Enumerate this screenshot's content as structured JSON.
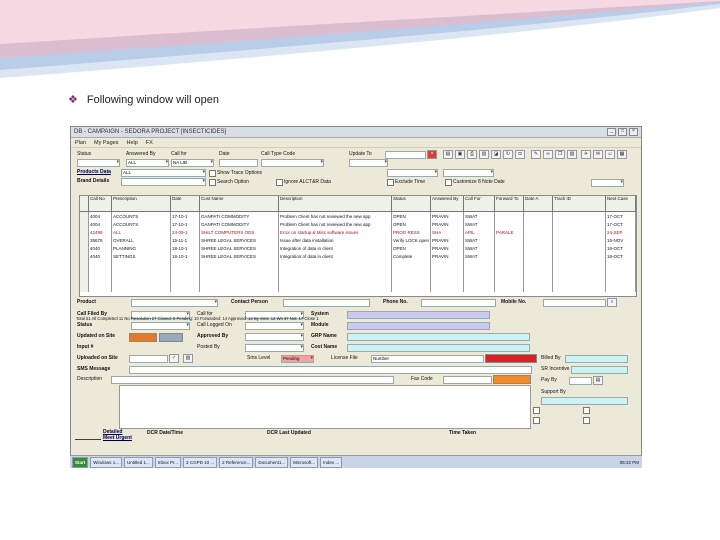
{
  "slide": {
    "bullet_text": "Following window will open",
    "accent": "#b03060",
    "deco_color": "#c9d9ee"
  },
  "window": {
    "title": "DB - CAMPAIGN - SEDORA PROJECT [INSECTICIDES]",
    "menu": [
      "Plan",
      "My Pages",
      "Help",
      "FX"
    ],
    "filters": {
      "status_label": "Status",
      "answered_by_label": "Answered By",
      "call_for_label": "Call for",
      "date_label": "Date",
      "call_type_label": "Call Type Code",
      "update_to_label": "Update To",
      "products_label": "Products Data",
      "brand_label": "Brand Details",
      "products_value": "ALL",
      "status_value": "",
      "answered_value": "ALL",
      "call_for_value": "NA LIB",
      "opt1": "Show Trace Options",
      "opt2": "Search Option",
      "opt3": "Ignore ALCT&R Data",
      "opt4": "Exclude Time",
      "opt5": "Customize 8 Note Date"
    },
    "grid": {
      "headers": [
        "Call No",
        "Prescription",
        "Date",
        "Cust Name",
        "Description",
        "Status",
        "Answered By",
        "Call For",
        "Forward To",
        "Date A",
        "Track ID",
        "Next Case"
      ],
      "rows": [
        {
          "red": false,
          "cells": [
            "4004",
            "ACCOUNTS",
            "17-10-1",
            "GANPATI COMMODITY",
            "Problem Client has not reviewed the new app",
            "OPEN",
            "PRAVIN",
            "SWAT",
            "",
            "",
            "",
            "17-OCT"
          ]
        },
        {
          "red": false,
          "cells": [
            "4004",
            "ACCOUNTS",
            "17-10-1",
            "GANPATI COMMODITY",
            "Problem Client has not reviewed the new app",
            "OPEN",
            "PRAVIN",
            "SWAT",
            "",
            "",
            "",
            "17-OCT"
          ]
        },
        {
          "red": true,
          "cells": [
            "42499",
            "ALL",
            "24-09-1",
            "SHILT COMPUTERS ODS",
            "Error on startup & Misc software issues",
            "PROG RESS",
            "SHA",
            "APIL",
            "PARALE",
            "",
            "",
            "24-SEP"
          ]
        },
        {
          "red": false,
          "cells": [
            "35678",
            "OVERALL",
            "15-11-1",
            "SHREE LEGAL SERVICES",
            "Issue after data installation",
            "Verify LOCK open",
            "PRAVIN",
            "SWAT",
            "",
            "",
            "",
            "15-NOV"
          ]
        },
        {
          "red": false,
          "cells": [
            "4040",
            "PLANNING",
            "18-10-1",
            "SHREE LEGAL SERVICES",
            "Integration of data in client",
            "OPEN",
            "PRAVIN",
            "SWAT",
            "",
            "",
            "",
            "18-OCT"
          ]
        },
        {
          "red": false,
          "cells": [
            "4040",
            "SETTINGS",
            "18-10-1",
            "SHREE LEGAL SERVICES",
            "Integration of data in client",
            "Complete",
            "PRAVIN",
            "SWAT",
            "",
            "",
            "",
            "18-OCT"
          ]
        }
      ]
    },
    "detail": {
      "product": "Product",
      "contact_person": "Contact Person",
      "phone_no": "Phone No.",
      "mobile_no": "Mobile No.",
      "call_filed_by": "Call Filed By",
      "call_for": "Call for",
      "system": "System",
      "status": "Status",
      "call_logged_on": "Call Logged On",
      "module": "Module",
      "updated_on_site": "Updated on Site",
      "approved_by": "Approved By",
      "grp_name": "GRP Name",
      "input": "Input #",
      "posted_by": "Posted By",
      "cost_name": "Cost Name",
      "uploaded_on_site": "Uploaded on Site",
      "sms_level": "Sms Level",
      "sms_level_value": "Pending",
      "license_file": "License File",
      "license_value": "Number",
      "sms_message": "SMS Message",
      "description": "Description",
      "fax_code": "Fax Code",
      "billed_by": "Billed By",
      "sr_incentive": "SR Incentive",
      "pay_by": "Pay By",
      "support_by": "Support By",
      "detailed": "Detailed",
      "meet_urgent": "Meet Urgent",
      "dcr_date_time": "DCR Date/Time",
      "dcr_last_updated": "DCR Last Updated",
      "time_taken": "Time Taken",
      "status_line": "Total 51 All    Completed 11 No Resolution 27 Closed: 8 Pending: 10  Forwarded: 14  Approved: 12  By Sms: 12  Wo 37  Not: 17  Close 1"
    },
    "taskbar": {
      "start": "Start",
      "buttons": [
        "Windows 1...",
        "Untitled 1...",
        "Inbox Pr...",
        "2 CGPD 10 ...",
        "2 Reference...",
        "",
        "Document1...",
        "Microsoft...",
        "Index ..."
      ],
      "clock": "05:22 PM"
    }
  }
}
